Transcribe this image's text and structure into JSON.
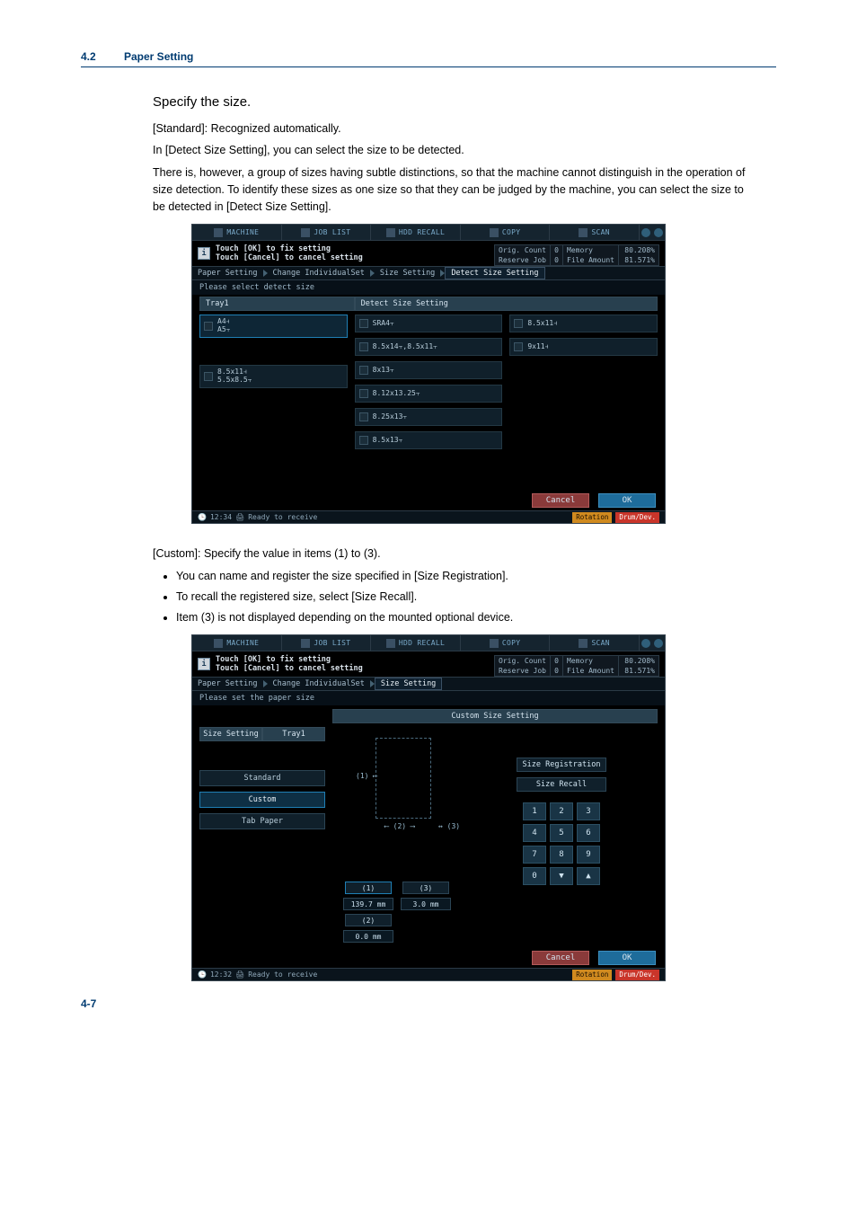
{
  "header": {
    "section": "4.2",
    "title": "Paper Setting"
  },
  "intro": {
    "lead": "Specify the size.",
    "p1": "[Standard]: Recognized automatically.",
    "p2": "In [Detect Size Setting], you can select the size to be detected.",
    "p3": "There is, however, a group of sizes having subtle distinctions, so that the machine cannot distinguish in the operation of size detection. To identify these sizes as one size so that they can be judged by the machine, you can select the size to be detected in [Detect Size Setting]."
  },
  "shot1": {
    "tabs": [
      "MACHINE",
      "JOB LIST",
      "HDD RECALL",
      "COPY",
      "SCAN"
    ],
    "info_lines": [
      "Touch [OK] to fix setting",
      "Touch [Cancel] to cancel setting"
    ],
    "mini": {
      "r1": [
        "Orig. Count",
        "0",
        "Memory",
        "80.208%"
      ],
      "r2": [
        "Reserve Job",
        "0",
        "File Amount",
        "81.571%"
      ]
    },
    "crumb": [
      "Paper Setting",
      "Change IndividualSet",
      "Size Setting",
      "Detect Size Setting"
    ],
    "subheader": "Please select detect size",
    "col_headers": [
      "Tray1",
      "Detect Size Setting"
    ],
    "left_col": [
      {
        "l1": "A4⫞",
        "l2": "A5⫟",
        "sel": true
      },
      {
        "l1": "8.5x11⫞",
        "l2": "5.5x8.5⫟",
        "sel": false
      }
    ],
    "mid_col": [
      "SRA4⫟",
      "8.5x14⫟,8.5x11⫟",
      "8x13⫟",
      "8.12x13.25⫟",
      "8.25x13⫟",
      "8.5x13⫟"
    ],
    "right_col": [
      "8.5x11⫞",
      "9x11⫞"
    ],
    "buttons": {
      "cancel": "Cancel",
      "ok": "OK"
    },
    "status": {
      "time": "12:34",
      "msg": "Ready to receive",
      "rotation": "Rotation",
      "drum": "Drum/Dev."
    }
  },
  "mid_text": {
    "p": "[Custom]: Specify the value in items (1) to (3).",
    "bullets": [
      "You can name and register the size specified in [Size Registration].",
      "To recall the registered size, select [Size Recall].",
      "Item (3) is not displayed depending on the mounted optional device."
    ]
  },
  "shot2": {
    "tabs": [
      "MACHINE",
      "JOB LIST",
      "HDD RECALL",
      "COPY",
      "SCAN"
    ],
    "info_lines": [
      "Touch [OK] to fix setting",
      "Touch [Cancel] to cancel setting"
    ],
    "mini": {
      "r1": [
        "Orig. Count",
        "0",
        "Memory",
        "80.208%"
      ],
      "r2": [
        "Reserve Job",
        "0",
        "File Amount",
        "81.571%"
      ]
    },
    "crumb": [
      "Paper Setting",
      "Change IndividualSet",
      "Size Setting"
    ],
    "crumb_active_index": 2,
    "subheader": "Please set the paper size",
    "side_header": "Size Setting",
    "side_tray": "Tray1",
    "side_buttons": [
      "Standard",
      "Custom",
      "Tab Paper"
    ],
    "side_selected": 1,
    "custom_header": "Custom Size Setting",
    "dim_buttons": {
      "one": "(1)",
      "two": "(2)",
      "three": "(3)"
    },
    "dim_values": {
      "one": "139.7  mm",
      "two": "0.0  mm",
      "three": "3.0  mm"
    },
    "right": {
      "reg": "Size Registration",
      "recall": "Size Recall"
    },
    "keypad": [
      "1",
      "2",
      "3",
      "4",
      "5",
      "6",
      "7",
      "8",
      "9",
      "0",
      "▼",
      "▲"
    ],
    "buttons": {
      "cancel": "Cancel",
      "ok": "OK"
    },
    "status": {
      "time": "12:32",
      "msg": "Ready to receive",
      "rotation": "Rotation",
      "drum": "Drum/Dev."
    }
  },
  "footer": "4-7"
}
